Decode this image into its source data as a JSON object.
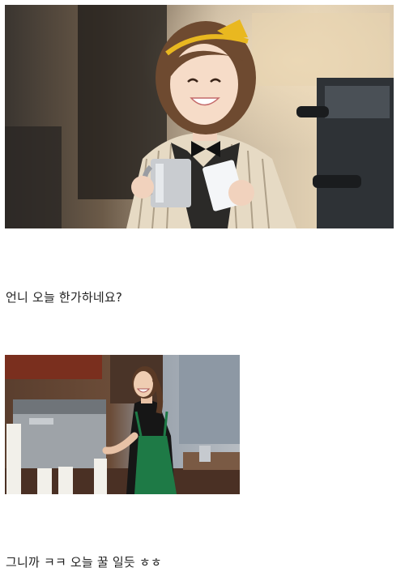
{
  "post": {
    "captions": [
      "언니 오늘 한가하네요?",
      "그니까 ㅋㅋ 오늘 꿀 일듯 ㅎㅎ"
    ]
  },
  "colors": {
    "background": "#ffffff",
    "text": "#222222",
    "apron_green": "#1e7a46"
  }
}
